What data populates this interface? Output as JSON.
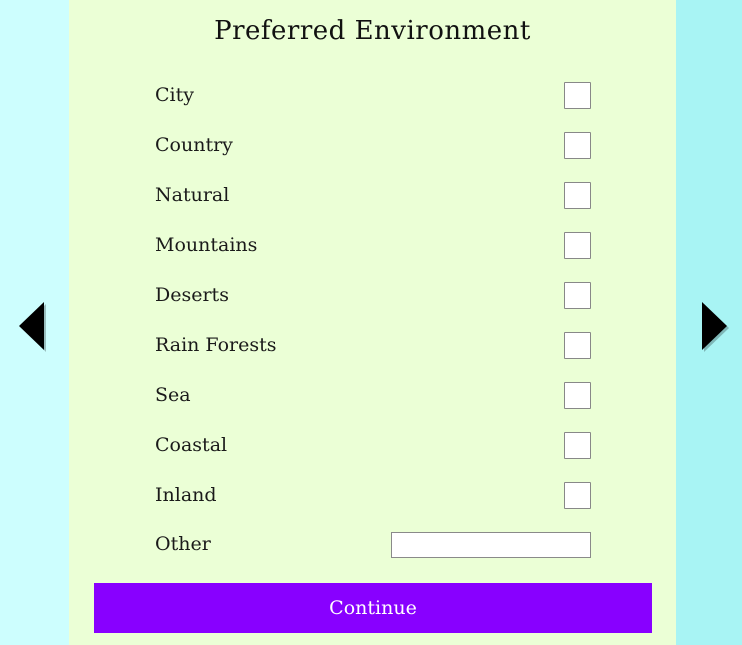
{
  "title": "Preferred Environment",
  "options": [
    {
      "label": "City",
      "checked": false
    },
    {
      "label": "Country",
      "checked": false
    },
    {
      "label": "Natural",
      "checked": false
    },
    {
      "label": "Mountains",
      "checked": false
    },
    {
      "label": "Deserts",
      "checked": false
    },
    {
      "label": "Rain Forests",
      "checked": false
    },
    {
      "label": "Sea",
      "checked": false
    },
    {
      "label": "Coastal",
      "checked": false
    },
    {
      "label": "Inland",
      "checked": false
    }
  ],
  "other": {
    "label": "Other",
    "value": "",
    "placeholder": ""
  },
  "continue_label": "Continue",
  "nav": {
    "prev_icon": "triangle-left-icon",
    "next_icon": "triangle-right-icon"
  },
  "colors": {
    "panel_bg": "#ebffd6",
    "side_bg": "#cdfefe",
    "accent": "#8800ff"
  }
}
